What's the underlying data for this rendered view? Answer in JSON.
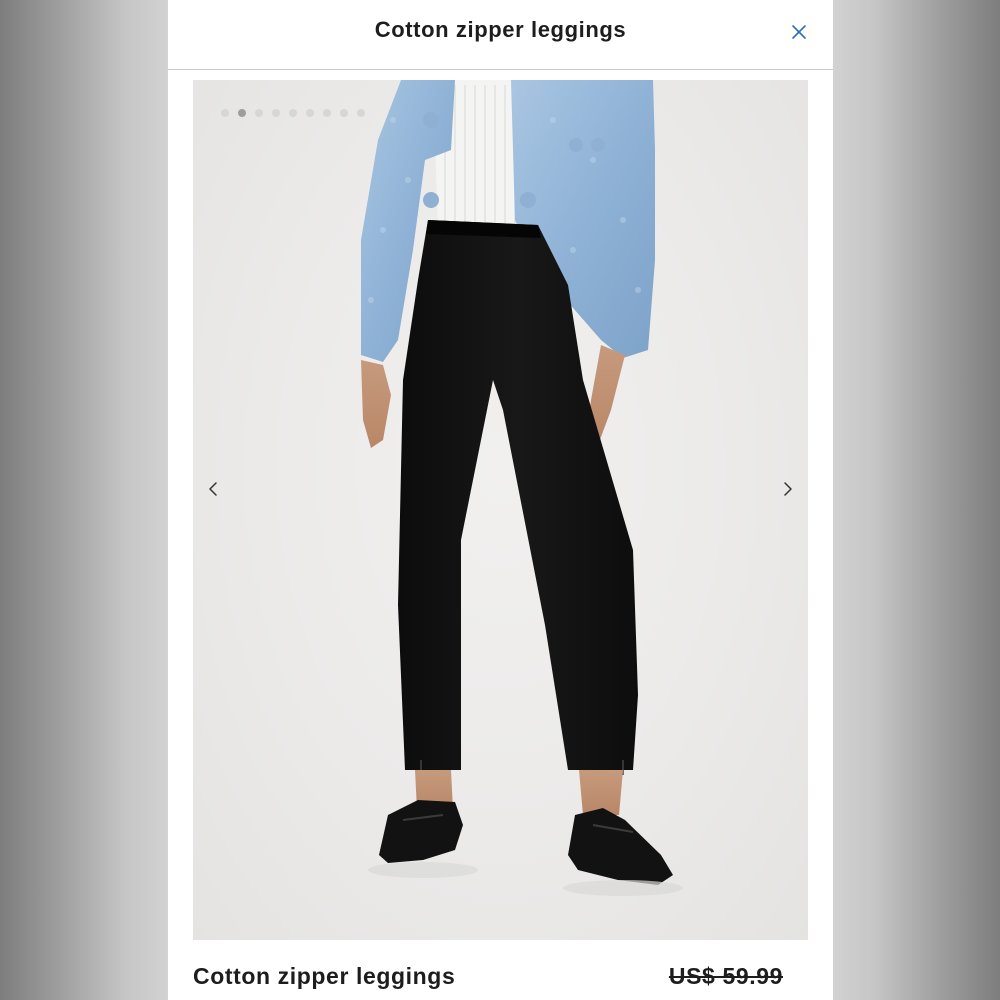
{
  "header": {
    "title": "Cotton zipper leggings",
    "close_icon": "close-icon"
  },
  "gallery": {
    "image_count": 9,
    "active_index": 1,
    "prev_icon": "chevron-left-icon",
    "next_icon": "chevron-right-icon",
    "image_alt": "Model wearing black cotton zipper leggings with light blue jacket and black loafers"
  },
  "product": {
    "name": "Cotton zipper leggings",
    "price": "US$ 59.99"
  },
  "colors": {
    "accent": "#2a6fb8",
    "text": "#1d1d1d",
    "background": "#ffffff"
  }
}
